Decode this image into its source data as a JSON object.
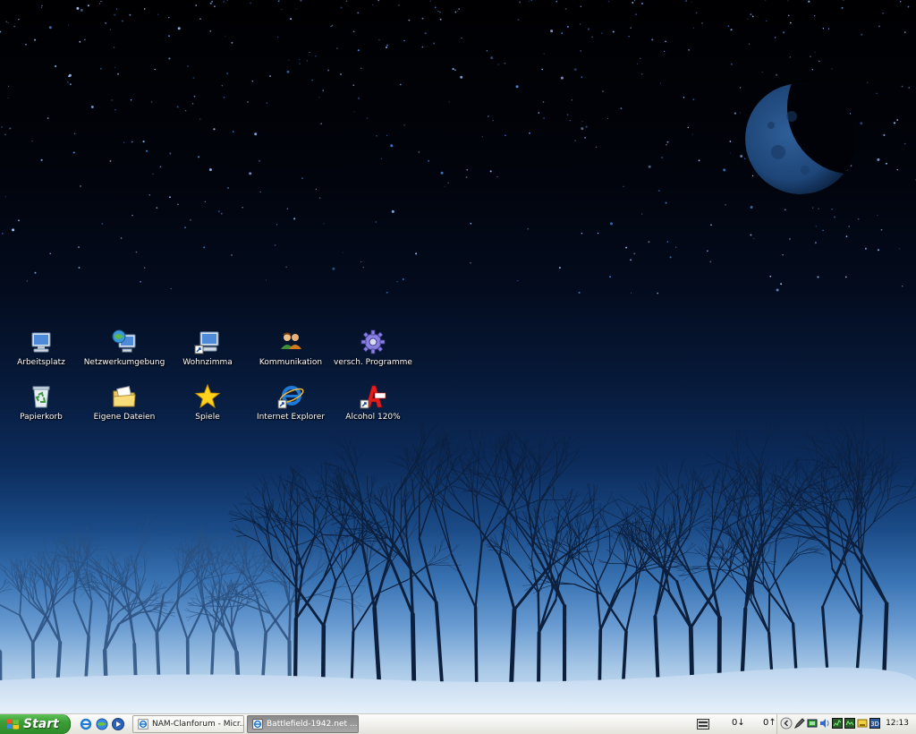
{
  "desktop": {
    "icons": [
      {
        "label": "Arbeitsplatz",
        "icon": "my-computer-icon"
      },
      {
        "label": "Netzwerkumgebung",
        "icon": "network-icon"
      },
      {
        "label": "Wohnzimma",
        "icon": "computer-shortcut-icon"
      },
      {
        "label": "Kommunikation",
        "icon": "users-icon"
      },
      {
        "label": "versch. Programme",
        "icon": "gear-icon"
      },
      {
        "label": "Papierkorb",
        "icon": "recycle-bin-icon"
      },
      {
        "label": "Eigene Dateien",
        "icon": "folder-icon"
      },
      {
        "label": "Spiele",
        "icon": "star-icon"
      },
      {
        "label": "Internet Explorer",
        "icon": "ie-icon"
      },
      {
        "label": "Alcohol 120%",
        "icon": "alcohol-icon"
      }
    ]
  },
  "taskbar": {
    "start_label": "Start",
    "quick_launch": [
      "ie-icon",
      "ie-icon",
      "media-player-icon"
    ],
    "tasks": [
      {
        "label": "NAM-Clanforum - Micr...",
        "icon": "ie-icon",
        "active": false
      },
      {
        "label": "Battlefield-1942.net ...",
        "icon": "ie-icon",
        "active": true
      }
    ],
    "net_down": "0↓",
    "net_up": "0↑",
    "clock": "12:13"
  },
  "colors": {
    "start_green": "#3c9d36",
    "taskbar": "#ecebe5",
    "sky_top": "#000002",
    "horizon": "#6a9cd2"
  }
}
